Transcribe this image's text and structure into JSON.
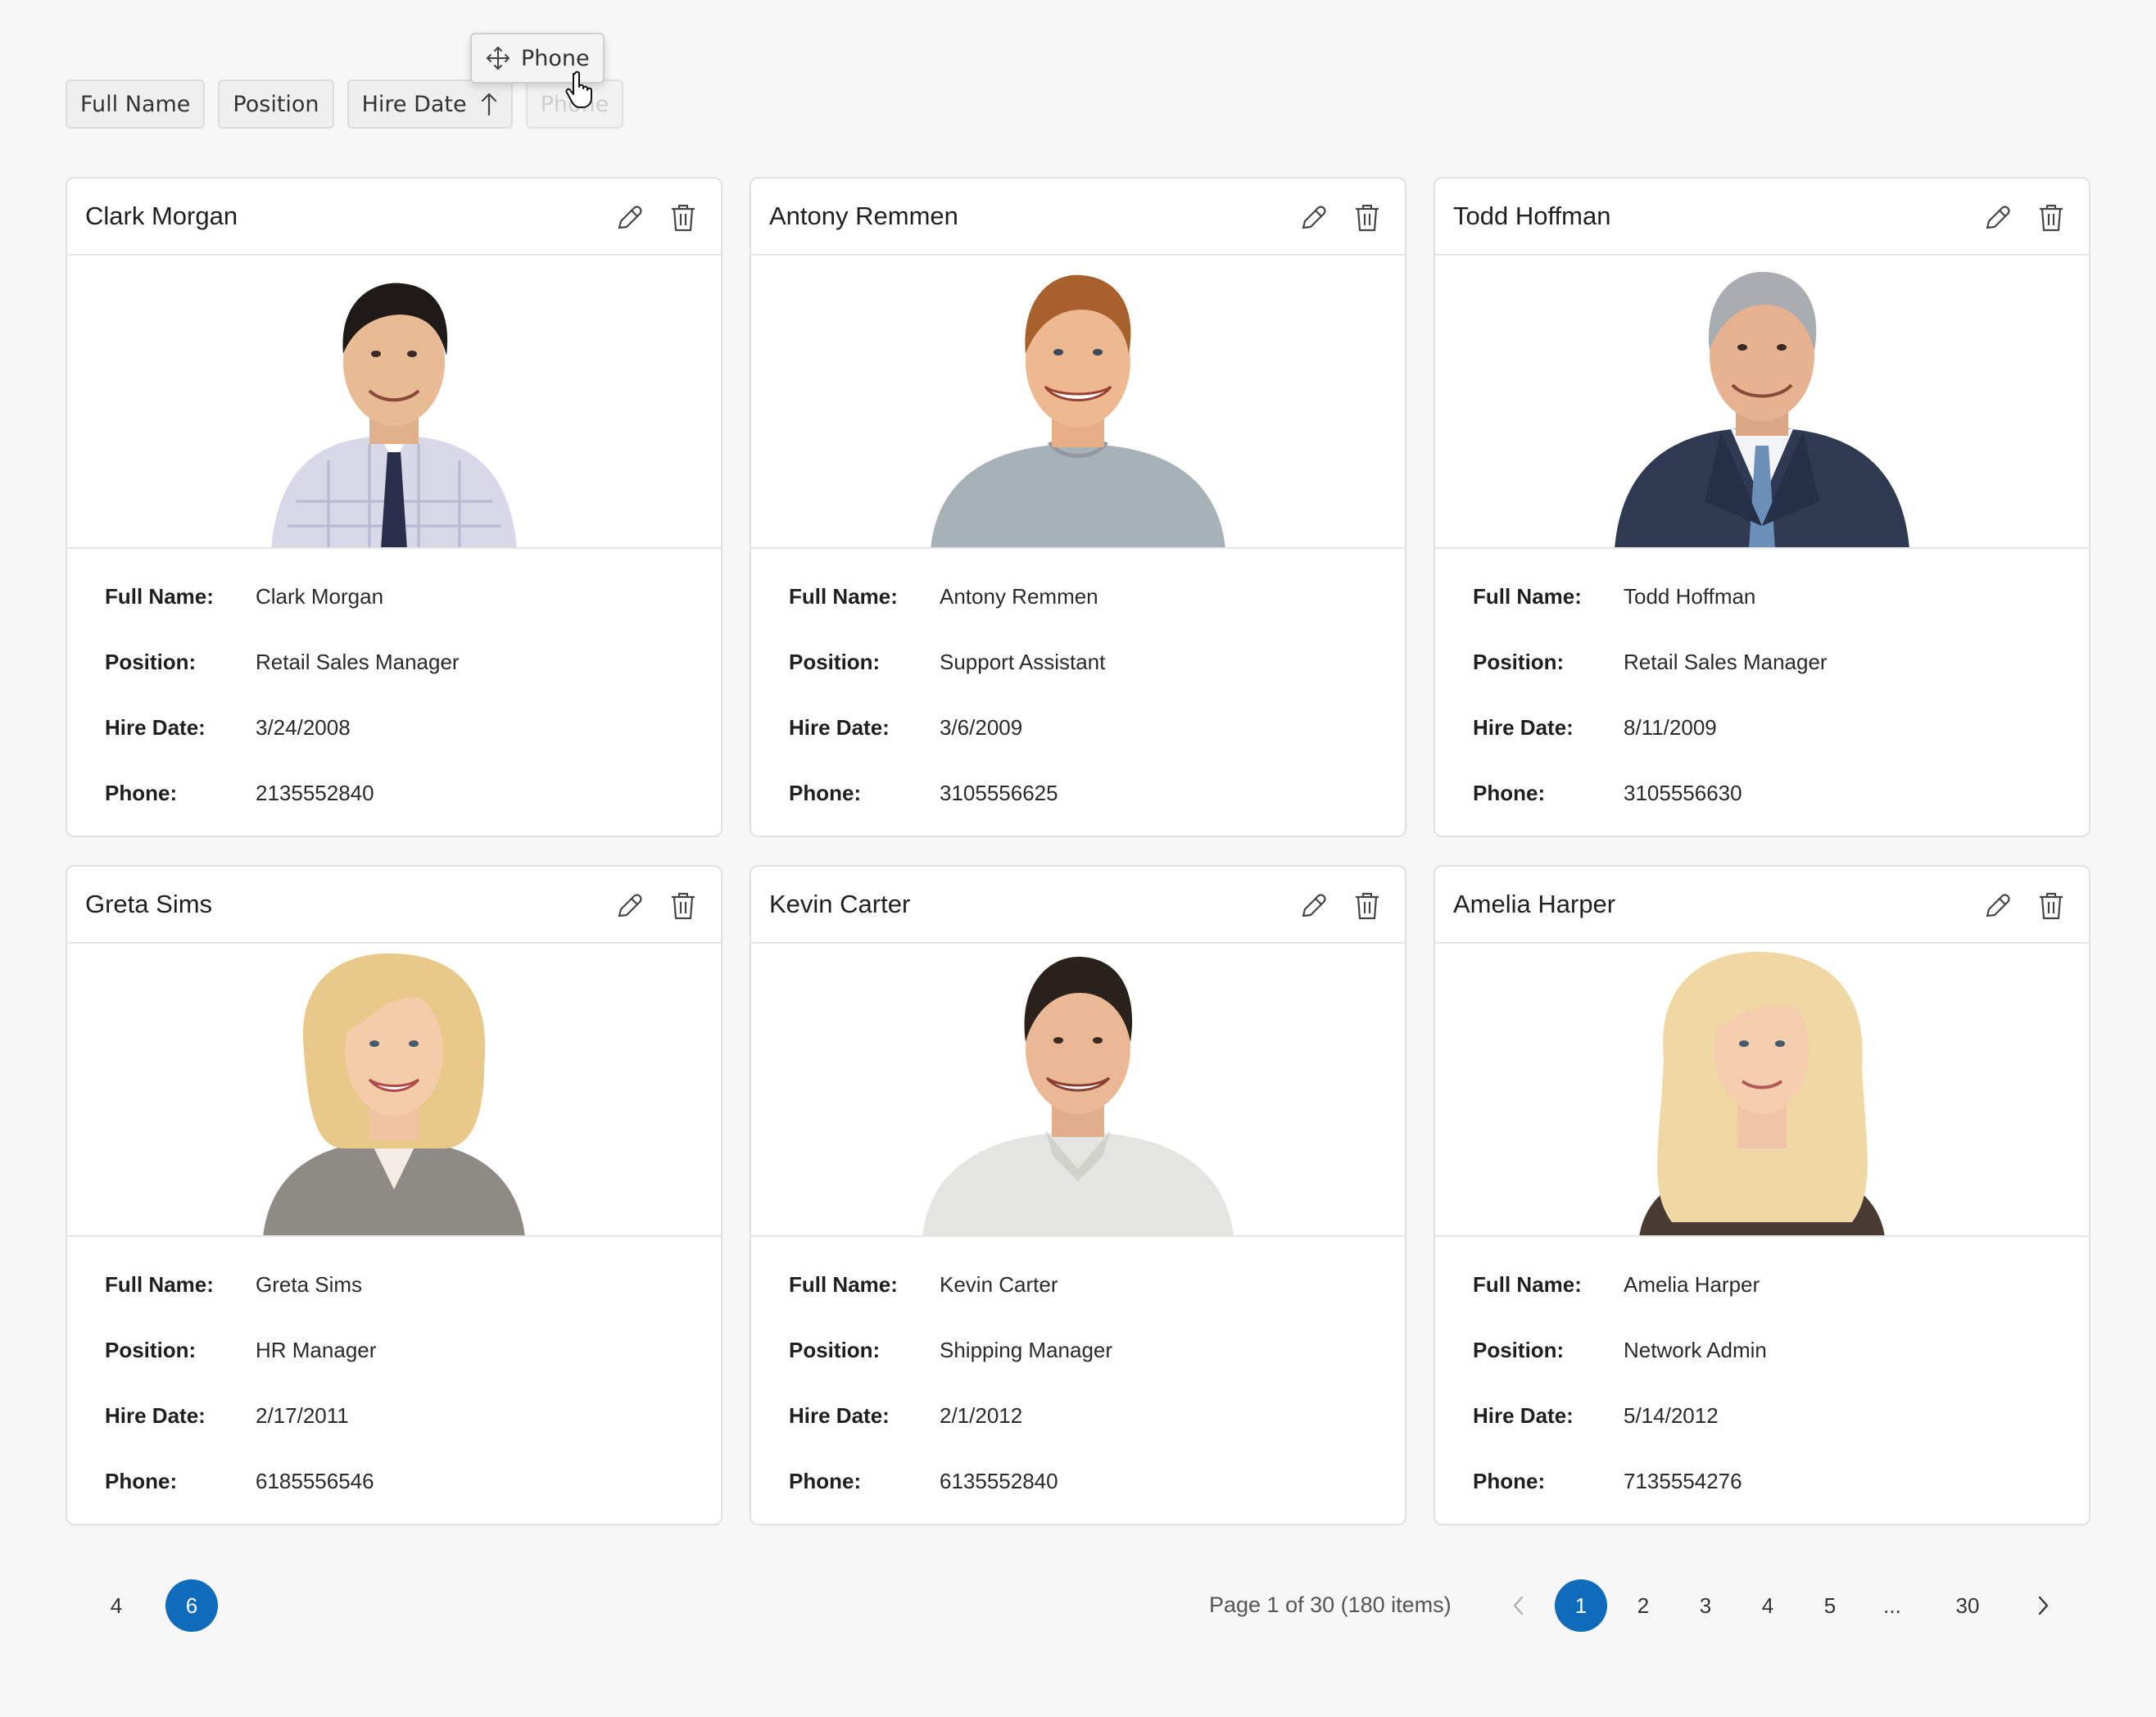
{
  "column_chips": [
    {
      "label": "Full Name"
    },
    {
      "label": "Position"
    },
    {
      "label": "Hire Date",
      "sort": "ascending"
    },
    {
      "label": "Phone",
      "state": "placeholder"
    }
  ],
  "dragging_chip": {
    "label": "Phone"
  },
  "field_labels": {
    "full_name": "Full Name:",
    "position": "Position:",
    "hire_date": "Hire Date:",
    "phone": "Phone:"
  },
  "cards": [
    {
      "title": "Clark Morgan",
      "full_name": "Clark Morgan",
      "position": "Retail Sales Manager",
      "hire_date": "3/24/2008",
      "phone": "2135552840"
    },
    {
      "title": "Antony Remmen",
      "full_name": "Antony Remmen",
      "position": "Support Assistant",
      "hire_date": "3/6/2009",
      "phone": "3105556625"
    },
    {
      "title": "Todd Hoffman",
      "full_name": "Todd Hoffman",
      "position": "Retail Sales Manager",
      "hire_date": "8/11/2009",
      "phone": "3105556630"
    },
    {
      "title": "Greta Sims",
      "full_name": "Greta Sims",
      "position": "HR Manager",
      "hire_date": "2/17/2011",
      "phone": "6185556546"
    },
    {
      "title": "Kevin Carter",
      "full_name": "Kevin Carter",
      "position": "Shipping Manager",
      "hire_date": "2/1/2012",
      "phone": "6135552840"
    },
    {
      "title": "Amelia Harper",
      "full_name": "Amelia Harper",
      "position": "Network Admin",
      "hire_date": "5/14/2012",
      "phone": "7135554276"
    }
  ],
  "page_size_options": [
    "4",
    "6"
  ],
  "page_size_selected": "6",
  "pager": {
    "info": "Page 1 of 30 (180 items)",
    "pages": [
      "1",
      "2",
      "3",
      "4",
      "5",
      "...",
      "30"
    ],
    "current": "1"
  },
  "colors": {
    "accent": "#0f6cbd",
    "card_border": "#e1e1e1",
    "background": "#f7f7f7"
  }
}
